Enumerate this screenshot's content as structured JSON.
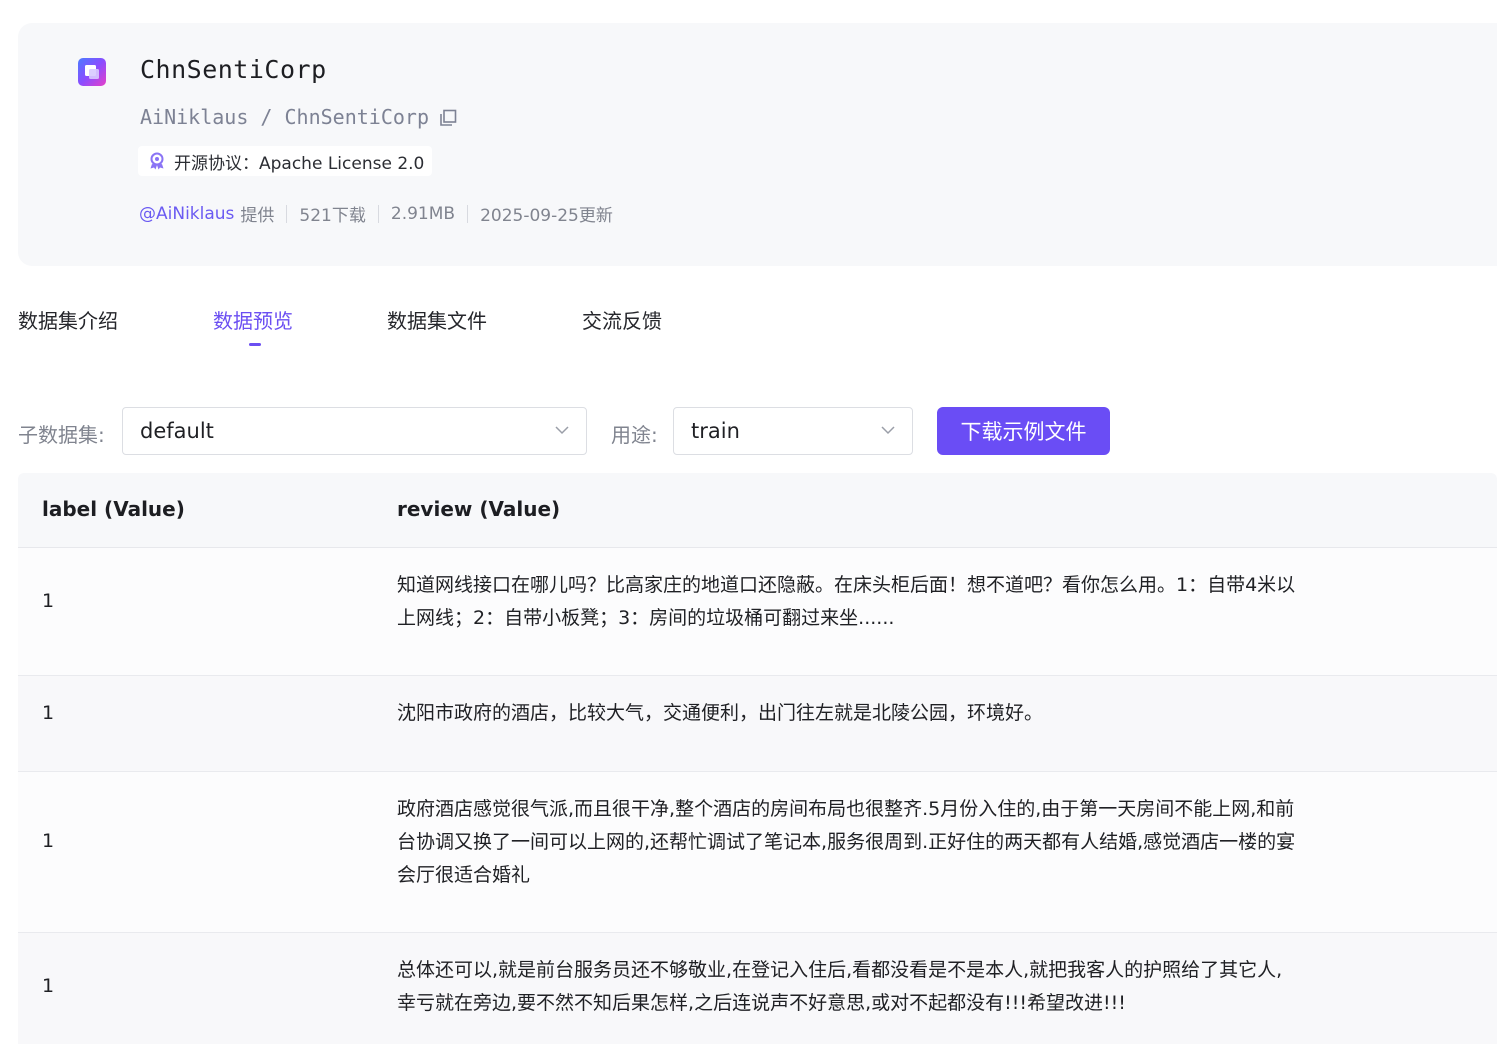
{
  "dataset": {
    "title": "ChnSentiCorp",
    "path": "AiNiklaus / ChnSentiCorp",
    "license": "开源协议：Apache License 2.0",
    "author": "@AiNiklaus",
    "author_suffix": "提供",
    "downloads": "521下载",
    "size": "2.91MB",
    "updated": "2025-09-25更新"
  },
  "tabs": [
    {
      "label": "数据集介绍",
      "active": false
    },
    {
      "label": "数据预览",
      "active": true
    },
    {
      "label": "数据集文件",
      "active": false
    },
    {
      "label": "交流反馈",
      "active": false
    }
  ],
  "filters": {
    "subset_label": "子数据集:",
    "subset_value": "default",
    "split_label": "用途:",
    "split_value": "train",
    "download_label": "下载示例文件"
  },
  "table": {
    "columns": [
      "label (Value)",
      "review (Value)"
    ],
    "rows": [
      {
        "label": "1",
        "review": "知道网线接口在哪儿吗？比高家庄的地道口还隐蔽。在床头柜后面！想不道吧？看你怎么用。1：自带4米以上网线；2：自带小板凳；3：房间的垃圾桶可翻过来坐......"
      },
      {
        "label": "1",
        "review": "沈阳市政府的酒店，比较大气，交通便利，出门往左就是北陵公园，环境好。"
      },
      {
        "label": "1",
        "review": "政府酒店感觉很气派,而且很干净,整个酒店的房间布局也很整齐.5月份入住的,由于第一天房间不能上网,和前台协调又换了一间可以上网的,还帮忙调试了笔记本,服务很周到.正好住的两天都有人结婚,感觉酒店一楼的宴会厅很适合婚礼"
      },
      {
        "label": "1",
        "review": "总体还可以,就是前台服务员还不够敬业,在登记入住后,看都没看是不是本人,就把我客人的护照给了其它人,幸亏就在旁边,要不然不知后果怎样,之后连说声不好意思,或对不起都没有!!!希望改进!!!"
      }
    ]
  },
  "colors": {
    "accent": "#6a4df5",
    "card_bg": "#f7f8fa"
  }
}
